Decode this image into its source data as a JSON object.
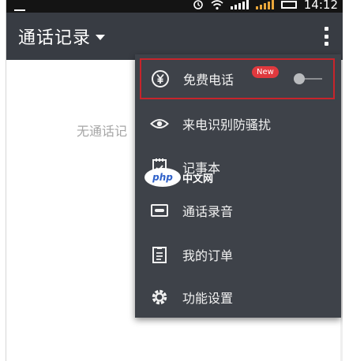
{
  "status_bar": {
    "time": "14:12",
    "icons": [
      "photo-icon",
      "alarm-icon",
      "wifi-icon",
      "signal-icon",
      "signal-icon",
      "battery-icon"
    ]
  },
  "app_bar": {
    "title": "通话记录",
    "title_dropdown_icon": "caret-down-icon",
    "overflow_icon": "more-vert-icon"
  },
  "main": {
    "empty_text": "无通话记"
  },
  "menu": {
    "items": [
      {
        "label": "免费电话",
        "icon": "yuan-icon",
        "badge": "New",
        "toggle_on": false,
        "highlighted": true
      },
      {
        "label": "来电识别防骚扰",
        "icon": "eye-icon"
      },
      {
        "label": "记事本",
        "icon": "notepad-icon"
      },
      {
        "label": "通话录音",
        "icon": "recorder-icon"
      },
      {
        "label": "我的订单",
        "icon": "clipboard-icon"
      },
      {
        "label": "功能设置",
        "icon": "gear-icon"
      }
    ]
  },
  "watermark": {
    "logo_text": "php",
    "site_text": "中文网"
  },
  "colors": {
    "app_bar": "#383c43",
    "menu_bg": "#3e4249",
    "highlight_border": "#c8242b",
    "badge": "#e0393e"
  }
}
